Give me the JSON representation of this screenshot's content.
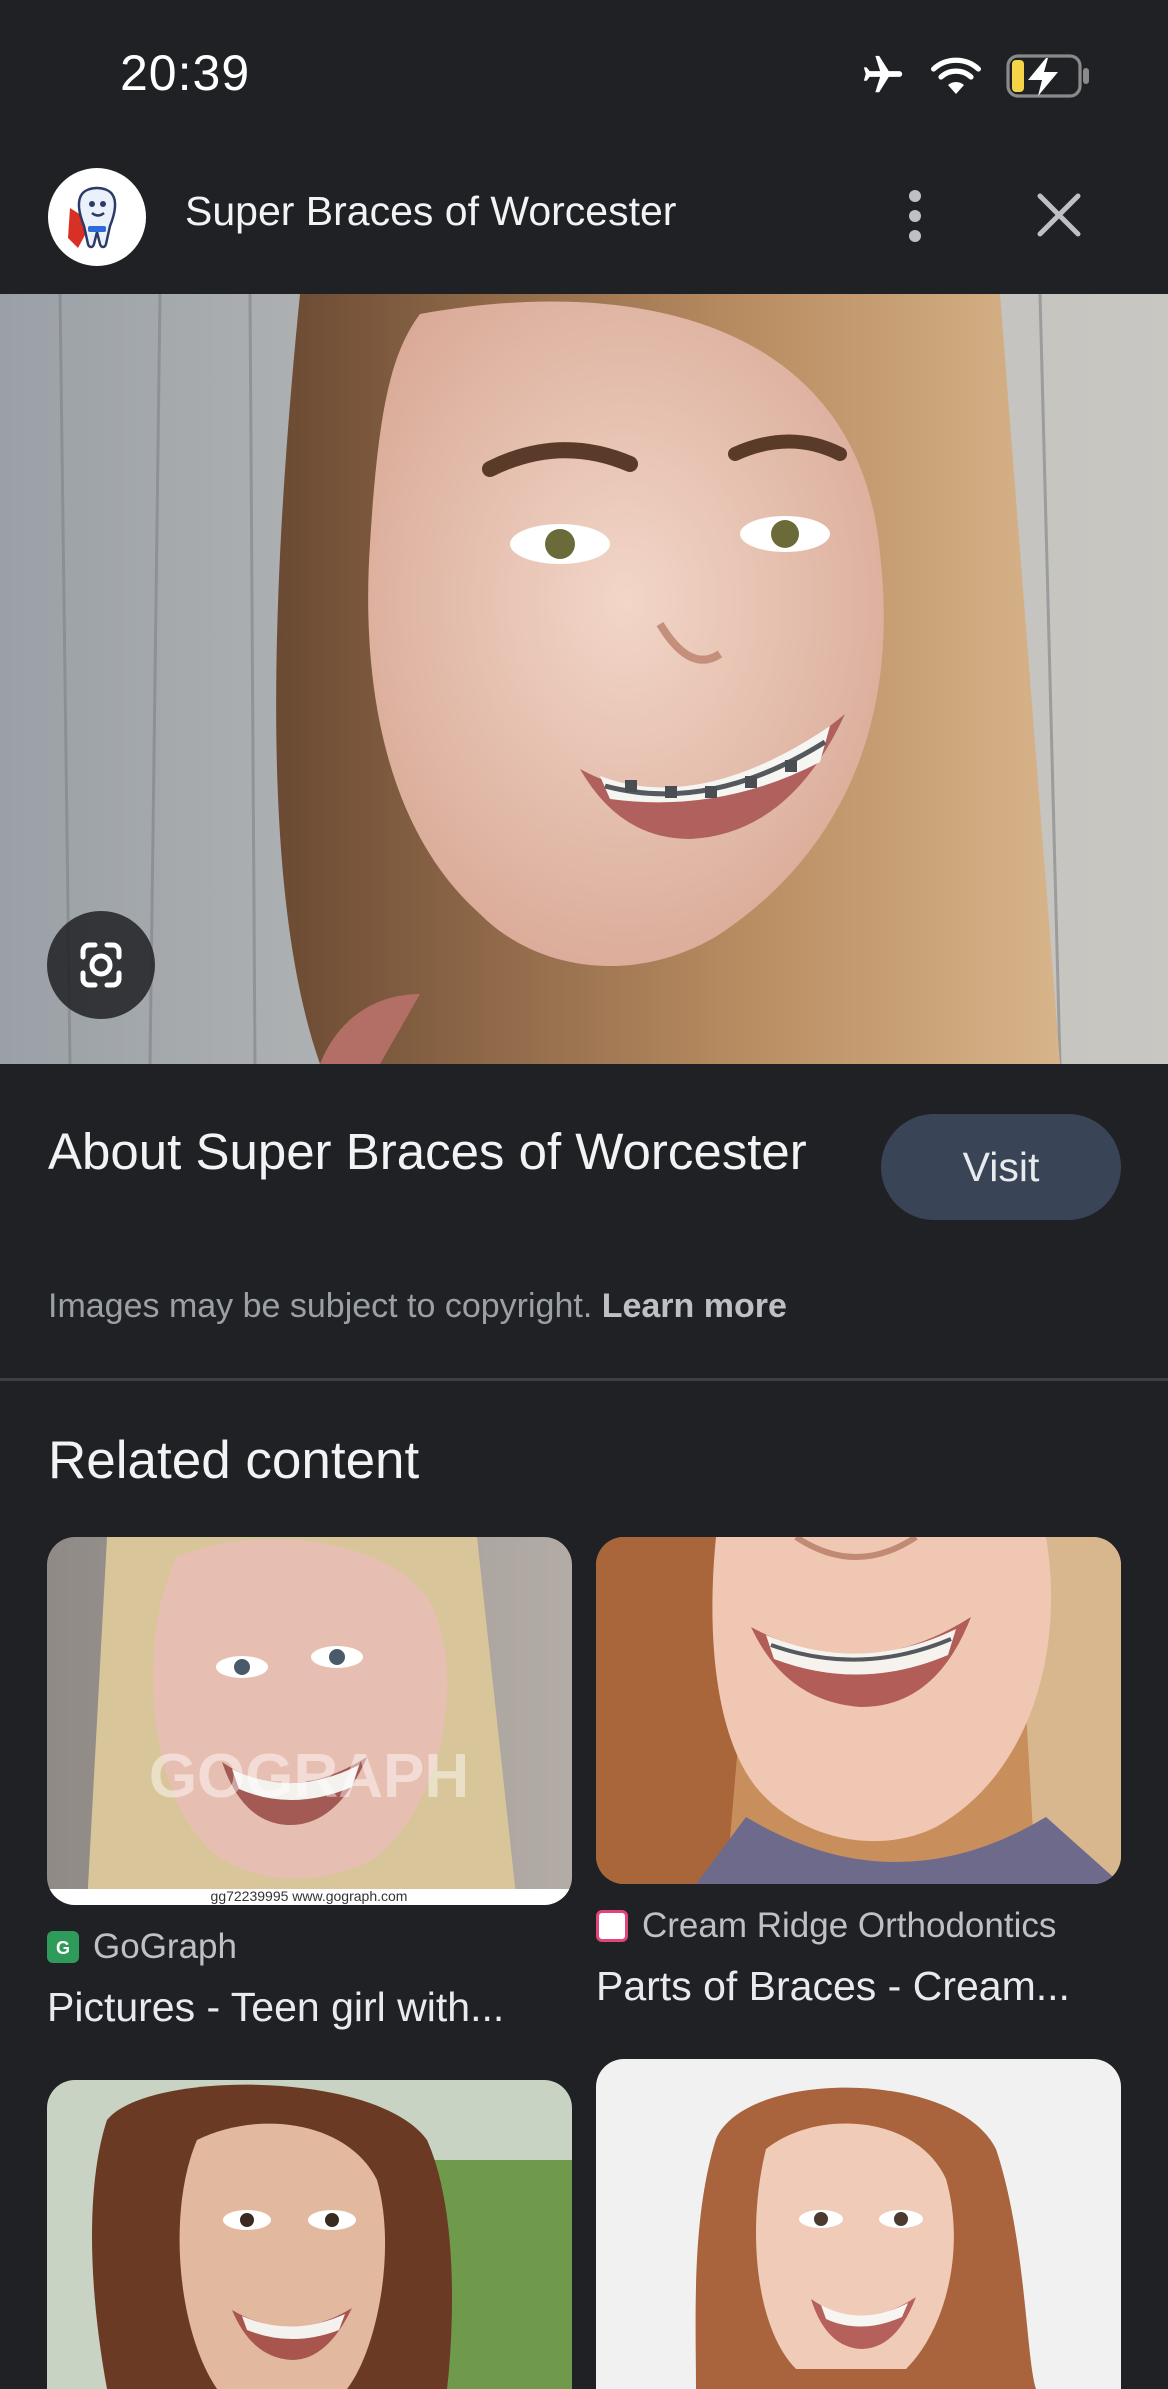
{
  "status_bar": {
    "time": "20:39",
    "icons": [
      "airplane-icon",
      "wifi-icon",
      "battery-charging-icon"
    ]
  },
  "header": {
    "title": "Super Braces of Worcester",
    "avatar_icon": "tooth-mascot-logo",
    "menu_icon": "more-vert-icon",
    "close_icon": "close-icon"
  },
  "main_image": {
    "lens_icon": "google-lens-icon"
  },
  "about": {
    "title": "About Super Braces of Worcester",
    "visit_label": "Visit",
    "copyright_text": "Images may be subject to copyright.",
    "learn_more": "Learn more"
  },
  "related": {
    "title": "Related content",
    "items": [
      {
        "source": "GoGraph",
        "caption": "Pictures - Teen girl with...",
        "watermark": "GOGRAPH",
        "footer": "gg72239995  www.gograph.com"
      },
      {
        "source": "Cream Ridge Orthodontics",
        "caption": "Parts of Braces - Cream..."
      },
      {
        "source": "",
        "caption": ""
      },
      {
        "source": "",
        "caption": ""
      }
    ]
  },
  "colors": {
    "background": "#202124",
    "visit_button": "#394457",
    "text_secondary": "#9aa0a6"
  }
}
